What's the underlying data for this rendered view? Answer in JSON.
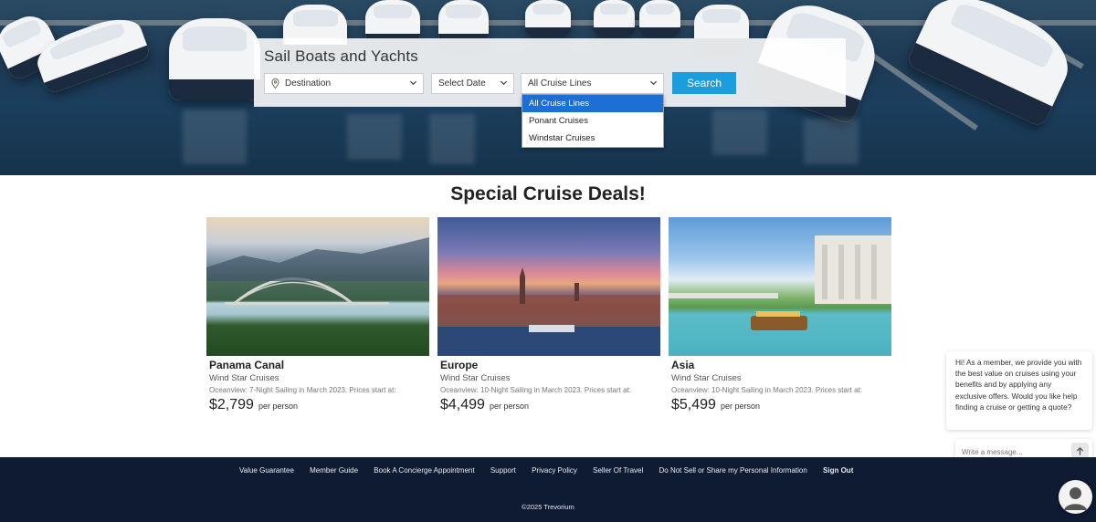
{
  "search": {
    "title": "Sail Boats and Yachts",
    "destination_placeholder": "Destination",
    "date_placeholder": "Select Date",
    "cruise_line_value": "All Cruise Lines",
    "search_label": "Search",
    "cruise_line_options": [
      "All Cruise Lines",
      "Ponant Cruises",
      "Windstar Cruises"
    ]
  },
  "deals": {
    "title": "Special Cruise Deals!",
    "cards": [
      {
        "name": "Panama Canal",
        "line": "Wind Star Cruises",
        "desc": "Oceanview: 7-Night Sailing in March 2023. Prices start at:",
        "price": "$2,799",
        "per": "per person"
      },
      {
        "name": "Europe",
        "line": "Wind Star Cruises",
        "desc": "Oceanview: 10-Night Sailing in March 2023. Prices start at:",
        "price": "$4,499",
        "per": "per person"
      },
      {
        "name": "Asia",
        "line": "Wind Star Cruises",
        "desc": "Oceanview: 10-Night Sailing in March 2023. Prices start at:",
        "price": "$5,499",
        "per": "per person"
      }
    ]
  },
  "chat": {
    "message": "Hi! As a member, we provide you with the best value on cruises using your benefits and by applying any exclusive offers. Would you like help finding a cruise or getting a quote?",
    "input_placeholder": "Write a message..."
  },
  "footer": {
    "links": [
      "Value Guarantee",
      "Member Guide",
      "Book A Concierge Appointment",
      "Support",
      "Privacy Policy",
      "Seller Of Travel",
      "Do Not Sell or Share my Personal Information"
    ],
    "sign_out": "Sign Out",
    "copyright": "©2025 Trevorium"
  },
  "colors": {
    "accent": "#1a9ee0",
    "selected_option": "#1d6fd6",
    "footer_bg": "#0f1a33"
  }
}
